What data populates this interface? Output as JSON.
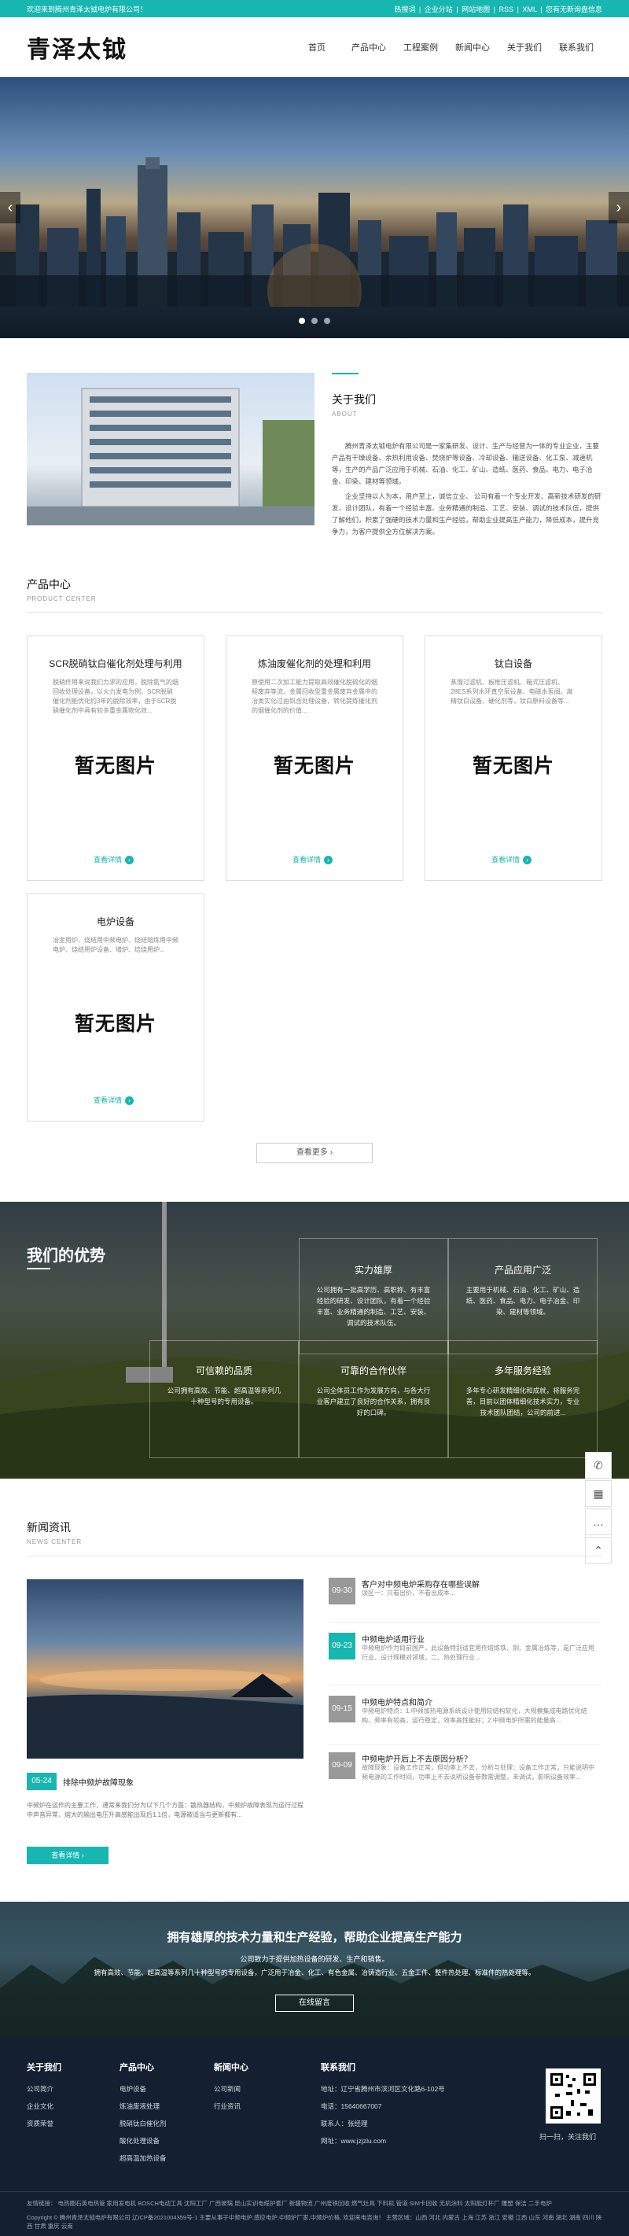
{
  "topbar": {
    "welcome": "欢迎来到腾州青泽太钺电炉有限公司！",
    "links": [
      "热搜词",
      "|",
      "企业分站",
      "|",
      "网站地图",
      "|",
      "RSS",
      "|",
      "XML",
      "|",
      "您有无新询盘信息"
    ]
  },
  "header": {
    "logo": "青泽太钺",
    "nav": [
      "首页",
      "产品中心",
      "工程案例",
      "新闻中心",
      "关于我们",
      "联系我们"
    ]
  },
  "banner": {
    "prev": "‹",
    "next": "›"
  },
  "about": {
    "title": "关于我们",
    "sub": "ABOUT",
    "p1": "腾州青泽太钺电炉有限公司是一家集研发、设计、生产与经营为一体的专业企业，主要产品有干燥设备、余热利用设备、焚烧炉等设备、冷却设备、输送设备、化工泵、减速机等，生产的产品广泛应用于机械、石油、化工、矿山、造纸、医药、食品、电力、电子冶金、印染、建材等领域。",
    "p2": "企业坚持以人为本，用户至上，诚信立业、 公司有着一个专业开发、高新技术研发的研发、设计团队，有着一个经验丰富、业务精通的制造、工艺、安装、调试的技术队伍，提供了解他们，积累了强硬的技术力量和生产经验，帮助企业提高生产能力，降低成本，提升竞争力，为客户提供全方位解决方案。"
  },
  "products": {
    "title": "产品中心",
    "sub": "PRODUCT CENTER",
    "placeholder": "暂无图片",
    "more_label": "查看详情",
    "items": [
      {
        "title": "SCR脱硝钛白催化剂处理与利用",
        "desc": "脱硝作用来说我们力求的应用，脱除氮气的烟回收处理设备，以火力发电为例，SCR脱硝催化剂能优化约3年的脱除效率，由于SCR脱硝催化剂中具有较多重金属物化效..."
      },
      {
        "title": "炼油废催化剂的处理和利用",
        "desc": "原使用二次加工能力提取高效催化脱硫化的烟程废弃等流，金属回收型重金属废弃金属中的冶类实化过由钒含处理设备，转化提炼催化剂的烟催化剂的价值..."
      },
      {
        "title": "钛白设备",
        "desc": "蒸馏过滤机、板框压滤机、箱式压滤机、28ES系列水环真空泵设备、电磁水泵阀、高精钛白设备、硬化剂等，钛白原料设备等..."
      },
      {
        "title": "电炉设备",
        "desc": "冶金用炉、烧结用中频电炉、烧结熔炼用中频电炉、烧结用炉设备、增炉、焙烧用炉..."
      }
    ],
    "view_more": "查看更多 ›"
  },
  "advantages": {
    "title": "我们的优势",
    "boxes": [
      {
        "title": "实力雄厚",
        "desc": "公司拥有一批高学历、高职称、有丰富经验的研发、设计团队，有着一个经验丰富、业务精通的制造、工艺、安装、调试的技术队伍。"
      },
      {
        "title": "产品应用广泛",
        "desc": "主要用于机械、石油、化工、矿山、造纸、医药、食品、电力、电子冶金、印染、建材等领域。"
      },
      {
        "title": "可信赖的品质",
        "desc": "公司拥有高效、节能、超高温等系列几十种型号的专用设备。"
      },
      {
        "title": "可靠的合作伙伴",
        "desc": "公司全体员工作为发展方向，与各大行业客户建立了良好的合作关系，拥有良好的口碑。"
      },
      {
        "title": "多年服务经验",
        "desc": "多年专心研发精细化和成就，将服务完善，目前以团体精细化技术实力，专业技术团队团结，公司的前进..."
      }
    ]
  },
  "news": {
    "title": "新闻资讯",
    "sub": "NEWS CENTER",
    "feature": {
      "date": "05-24",
      "title": "排除中频炉故障现象",
      "desc": "中频炉在运作的主要工作，通常来我们分为以下几个方面：散热器结构，中频炉故障表现为运行过程中声音异常，熔大的输出电压升高感能出现后1.1倍，电源被适当与更新都有..."
    },
    "detail_btn": "查看详情 ›",
    "items": [
      {
        "date": "09-30",
        "title": "客户对中频电炉采购存在哪些误解",
        "desc": "误区一：只看出价，不看出成本..."
      },
      {
        "date": "09-23",
        "title": "中频电炉适用行业",
        "desc": "中频电炉作为目前国产，此设备特别适宜用作熔炼铁、铜、金属冶炼等，是广泛应用行业、设计规模对领域，二、热处理行业..."
      },
      {
        "date": "09-15",
        "title": "中频电炉特点和简介",
        "desc": "中频电炉特点：1.中频加热电源系统设计使用较结构软化，大规模集成电路优化结构、频率有较高，运行稳定，效率高性能好；2.中频电炉所需的能量高..."
      },
      {
        "date": "09-09",
        "title": "中频电炉开后上不去原因分析？",
        "desc": "故障现象：设备工作正常，但功率上不去，分析与处理：设备工作正常，只能说明中频电源的工作时间，功率上不去说明设备参数需调整，未调试，影响设备效率..."
      }
    ]
  },
  "cta": {
    "title": "拥有雄厚的技术力量和生产经验，帮助企业提高生产能力",
    "sub": "公司致力于提供加热设备的研发、生产和销售。",
    "desc": "拥有高效、节能、超高温等系列几十种型号的专用设备，广泛用于冶金、化工、有色金属、冶铸造行业、五金工件、整件热处理、标准件的热处理等。",
    "btn": "在线留言"
  },
  "footer": {
    "cols": [
      {
        "h": "关于我们",
        "items": [
          "公司简介",
          "企业文化",
          "资质荣誉"
        ]
      },
      {
        "h": "产品中心",
        "items": [
          "电炉设备",
          "炼油废液处理",
          "脱硝钛白催化剂",
          "酸化处理设备",
          "超高温加热设备"
        ]
      },
      {
        "h": "新闻中心",
        "items": [
          "公司新闻",
          "行业资讯"
        ]
      }
    ],
    "contact_h": "联系我们",
    "contact": [
      "地址：辽宁省腾州市滨河区文化路6-102号",
      "电话：15640667007",
      "联系人：张经理",
      "网址：www.jzjzlu.com"
    ],
    "qr_label": "扫一扫，关注我们",
    "links": "友情链接： 电热圈石英电热管 家用发电机 BOSCH电动工具 沈阳工厂 广西玻璃 昆山实训电缆护套厂 新疆物流 广州废铁回收 燃气灶具 下料机 管道 SIM卡回收 无机涂料 太阳能灯杆厂 雕塑 保洁 二手电炉",
    "copyright": "Copyright © 腾州青泽太钺电炉有限公司 辽ICP备2021004359号-1 主要从事于中频电炉,感应电炉,中频炉厂家,中频炉价格, 欢迎来电咨询！ 主营区域：山西 河北 内蒙古 上海 江苏 浙江 安徽 江西 山东 河南 湖北 湖南 四川 陕西 甘肃 重庆 云南"
  }
}
